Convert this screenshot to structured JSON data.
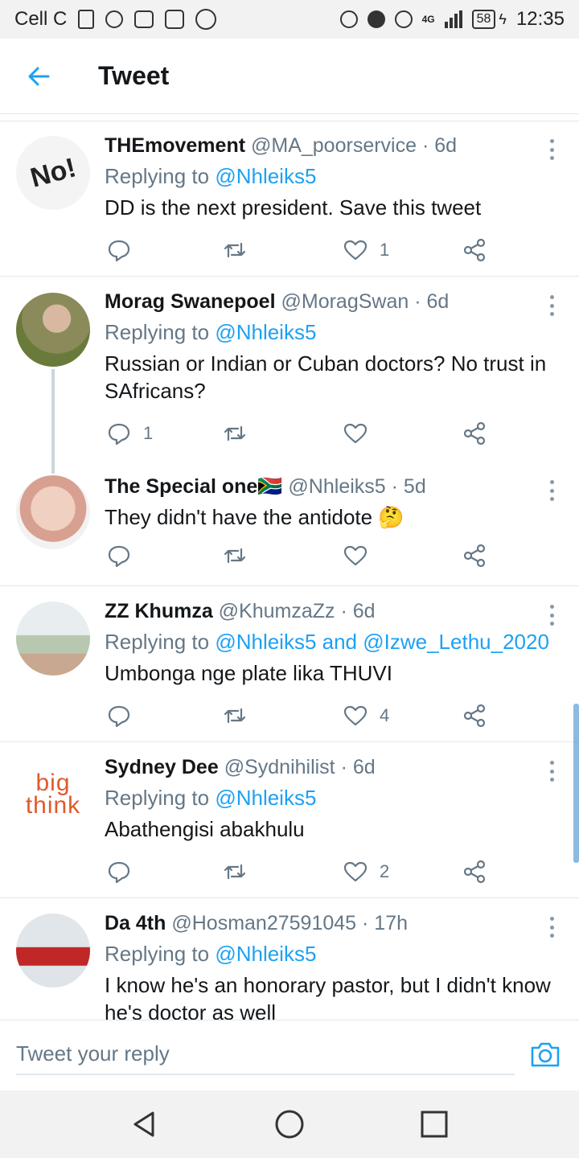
{
  "status_bar": {
    "carrier": "Cell C",
    "battery": "58",
    "time": "12:35",
    "network": "4G"
  },
  "header": {
    "title": "Tweet",
    "back_icon": "arrow-left-icon"
  },
  "tweets": [
    {
      "name": "THEmovement",
      "handle": "@MA_poorservice",
      "sep": "·",
      "time": "6d",
      "replying_label": "Replying to",
      "replying_to": "@Nhleiks5",
      "text": "DD is the next president. Save this tweet",
      "replies": "",
      "likes": "1"
    },
    {
      "name": "Morag Swanepoel",
      "handle": "@MoragSwan",
      "sep": "·",
      "time": "6d",
      "replying_label": "Replying to",
      "replying_to": "@Nhleiks5",
      "text": "Russian or Indian or Cuban doctors? No trust in SAfricans?",
      "replies": "1",
      "likes": ""
    },
    {
      "name": "The Special one🇿🇦",
      "handle": "@Nhleiks5",
      "sep": "·",
      "time": "5d",
      "text": "They didn't have the antidote 🤔",
      "replies": "",
      "likes": ""
    },
    {
      "name": "ZZ Khumza",
      "handle": "@KhumzaZz",
      "sep": "·",
      "time": "6d",
      "replying_label": "Replying to",
      "replying_to": "@Nhleiks5 and @Izwe_Lethu_2020",
      "text": "Umbonga nge plate lika THUVI",
      "replies": "",
      "likes": "4"
    },
    {
      "name": "Sydney Dee",
      "handle": "@Sydnihilist",
      "sep": "·",
      "time": "6d",
      "replying_label": "Replying to",
      "replying_to": "@Nhleiks5",
      "text": "Abathengisi abakhulu",
      "replies": "",
      "likes": "2",
      "avatar_text_1": "big",
      "avatar_text_2": "think"
    },
    {
      "name": "Da 4th",
      "handle": "@Hosman27591045",
      "sep": "·",
      "time": "17h",
      "replying_label": "Replying to",
      "replying_to": "@Nhleiks5",
      "text": "I know he's an honorary pastor, but I didn't know he's doctor as well",
      "replies": "",
      "likes": ""
    }
  ],
  "avatar_0_text": "No!",
  "reply_bar": {
    "placeholder": "Tweet your reply",
    "camera_icon": "camera-icon"
  },
  "colors": {
    "accent": "#1da1f2",
    "secondary_text": "#657786",
    "divider": "#e1e8ed"
  }
}
